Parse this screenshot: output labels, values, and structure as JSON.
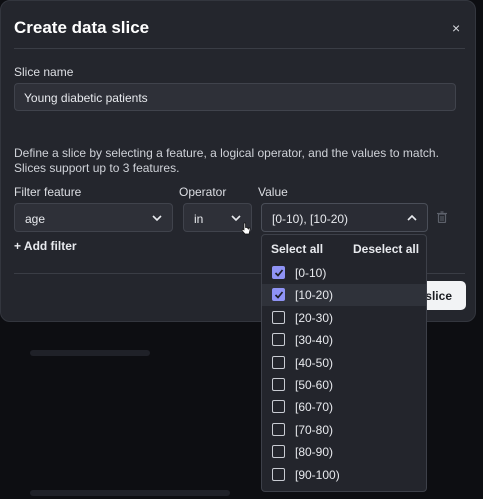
{
  "modal": {
    "title": "Create data slice",
    "close_glyph": "×",
    "slice_name_label": "Slice name",
    "slice_name_value": "Young diabetic patients",
    "description": "Define a slice by selecting a feature, a logical operator, and the values to match. Slices support up to 3 features.",
    "headers": {
      "feature": "Filter feature",
      "operator": "Operator",
      "value": "Value"
    },
    "filter": {
      "feature": "age",
      "operator": "in",
      "value": "[0-10), [10-20)"
    },
    "add_filter": "+ Add filter",
    "create_button": "Create slice",
    "create_button_visible": "slice"
  },
  "dropdown": {
    "select_all": "Select all",
    "deselect_all": "Deselect all",
    "options": [
      {
        "label": "[0-10)",
        "checked": true
      },
      {
        "label": "[10-20)",
        "checked": true
      },
      {
        "label": "[20-30)",
        "checked": false
      },
      {
        "label": "[30-40)",
        "checked": false
      },
      {
        "label": "[40-50)",
        "checked": false
      },
      {
        "label": "[50-60)",
        "checked": false
      },
      {
        "label": "[60-70)",
        "checked": false
      },
      {
        "label": "[70-80)",
        "checked": false
      },
      {
        "label": "[80-90)",
        "checked": false
      },
      {
        "label": "[90-100)",
        "checked": false
      }
    ]
  },
  "icons": {
    "close": "close-icon",
    "chevron": "chevron-down-icon",
    "chevron_open": "chevron-up-icon",
    "delete": "trash-icon",
    "check": "check-icon"
  },
  "colors": {
    "accent": "#8f93f5",
    "modal_bg": "#24262d",
    "page_bg": "#0d0e12"
  }
}
